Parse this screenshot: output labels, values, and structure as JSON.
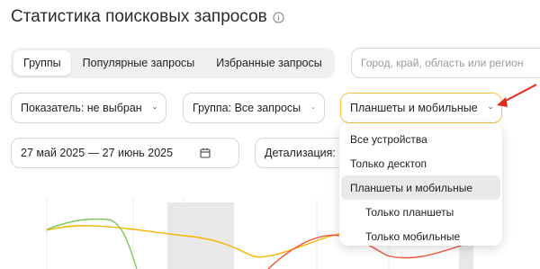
{
  "page": {
    "title": "Статистика поисковых запросов"
  },
  "tabs": [
    {
      "label": "Группы",
      "active": true
    },
    {
      "label": "Популярные запросы",
      "active": false
    },
    {
      "label": "Избранные запросы",
      "active": false
    }
  ],
  "region": {
    "placeholder": "Город, край, область или регион"
  },
  "filters": {
    "metric_label": "Показатель: не выбран",
    "group_label": "Группа: Все запросы",
    "device_label": "Планшеты и мобильные",
    "date_range": "27 май 2025 — 27 июнь 2025",
    "detail_label": "Детализация: п"
  },
  "device_options": [
    {
      "label": "Все устройства",
      "selected": false,
      "sub": false
    },
    {
      "label": "Только десктоп",
      "selected": false,
      "sub": false
    },
    {
      "label": "Планшеты и мобильные",
      "selected": true,
      "sub": false
    },
    {
      "label": "Только планшеты",
      "selected": false,
      "sub": true
    },
    {
      "label": "Только мобильные",
      "selected": false,
      "sub": true
    }
  ],
  "colors": {
    "accent_border": "#f5c242",
    "line_orange": "#f5b400",
    "line_green": "#7dc95e",
    "line_red": "#f2553d",
    "highlight_band": "#e8e8e8",
    "arrow": "#e52a1c"
  },
  "icons": {
    "info": "info-icon",
    "chevron": "chevron-down-icon",
    "calendar": "calendar-icon"
  }
}
